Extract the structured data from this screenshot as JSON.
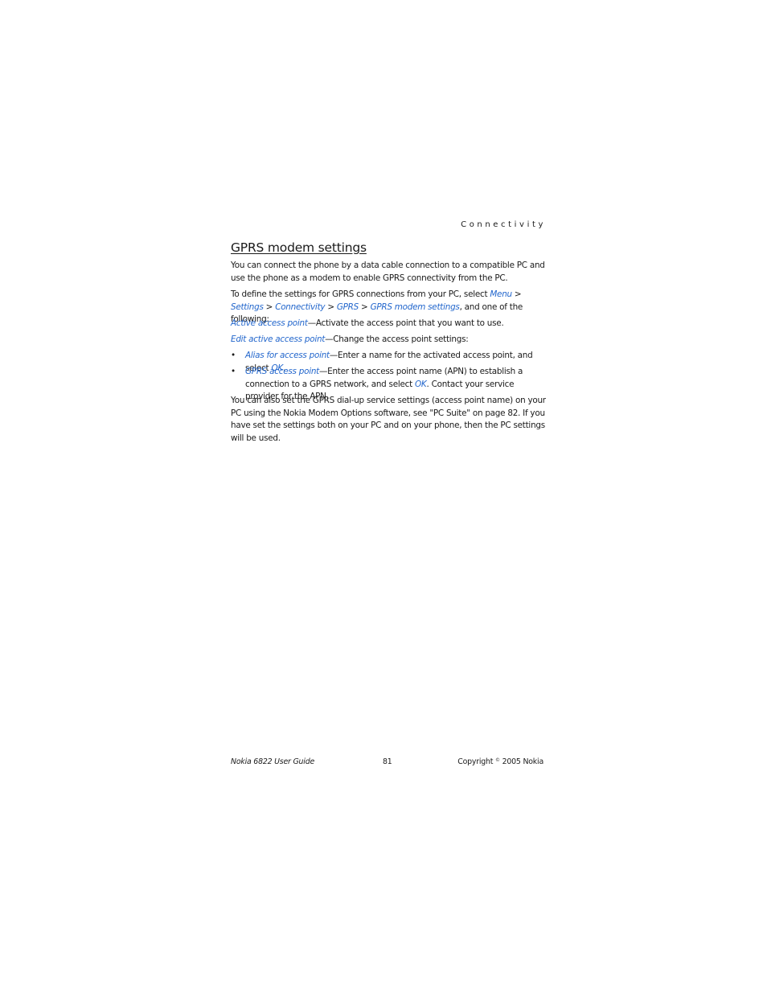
{
  "header": {
    "section": "Connectivity"
  },
  "title": "GPRS modem settings",
  "paragraphs": {
    "intro": "You can connect the phone by a data cable connection to a compatible PC and use the phone as a modem to enable GPRS connectivity from the PC.",
    "define": {
      "prefix": "To define the settings for GPRS connections from your PC, select ",
      "menu": "Menu",
      "sep1": " > ",
      "settings": "Settings",
      "sep2": " > ",
      "connectivity": "Connectivity",
      "sep3": " > ",
      "gprs": "GPRS",
      "sep4": " > ",
      "gprs_modem": "GPRS modem settings",
      "suffix": ", and one of the following:"
    },
    "active": {
      "link": "Active access point",
      "text": "—Activate the access point that you want to use."
    },
    "edit": {
      "link": "Edit active access point",
      "text": "—Change the access point settings:"
    },
    "bullets": [
      {
        "link": "Alias for access point",
        "text": "—Enter a name for the activated access point, and select ",
        "link2": "OK",
        "text2": "."
      },
      {
        "link": "GPRS access point",
        "text": "—Enter the access point name (APN) to establish a connection to a GPRS network, and select ",
        "link2": "OK",
        "text2": ". Contact your service provider for the APN."
      }
    ],
    "bullet_symbol": "•",
    "also": "You can also set the GPRS dial-up service settings (access point name) on your PC using the Nokia Modem Options software, see \"PC Suite\" on page 82. If you have set the settings both on your PC and on your phone, then the PC settings will be used."
  },
  "footer": {
    "guide": "Nokia 6822 User Guide",
    "page": "81",
    "copyright_prefix": "Copyright ",
    "copyright_symbol": "©",
    "copyright_suffix": " 2005 Nokia"
  },
  "colors": {
    "link": "#2266cc",
    "text": "#1a1a1a"
  }
}
